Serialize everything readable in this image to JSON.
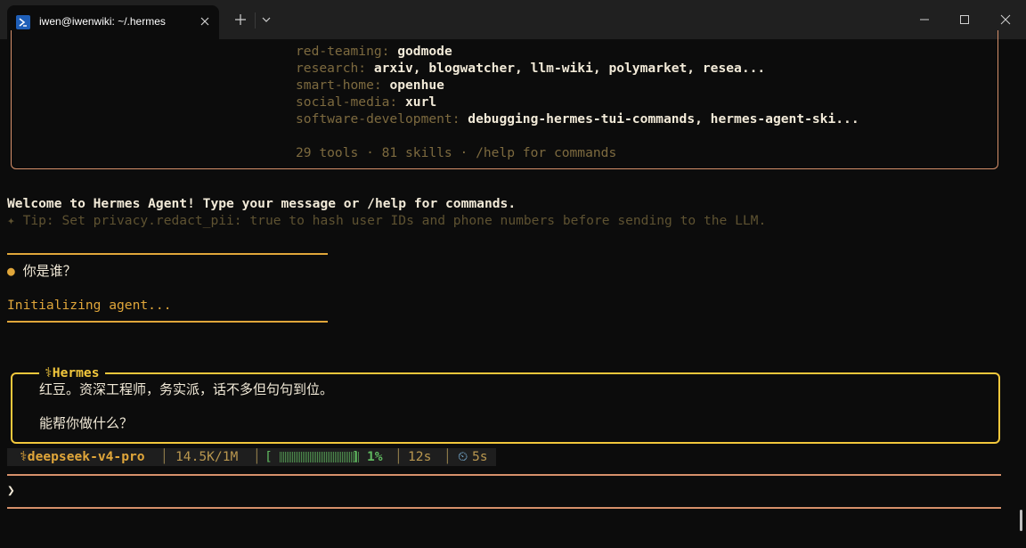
{
  "window": {
    "tab_title": "iwen@iwenwiki: ~/.hermes"
  },
  "banner": {
    "skills": [
      {
        "category": "red-teaming:",
        "items": " godmode"
      },
      {
        "category": "research:",
        "items": " arxiv, blogwatcher, llm-wiki, polymarket, resea..."
      },
      {
        "category": "smart-home:",
        "items": " openhue"
      },
      {
        "category": "social-media:",
        "items": " xurl"
      },
      {
        "category": "software-development:",
        "items": " debugging-hermes-tui-commands, hermes-agent-ski..."
      }
    ],
    "summary": "29 tools · 81 skills · /help for commands"
  },
  "welcome": "Welcome to Hermes Agent! Type your message or /help for commands.",
  "tip": "✦ Tip: Set privacy.redact_pii: true to hash user IDs and phone numbers before sending to the LLM.",
  "user_message": {
    "bullet": "●",
    "text": "你是谁？"
  },
  "init_status": "Initializing agent...",
  "response": {
    "label": "⚕Hermes",
    "lines": [
      "红豆。资深工程师，务实派，话不多但句句到位。",
      "能帮你做什么？"
    ]
  },
  "statusbar": {
    "model": "⚕deepseek-v4-pro",
    "sep": "│",
    "tokens": "14.5K/1M",
    "bar_open": "[",
    "bar_close": "]",
    "percent": "1%",
    "progress": 0.01,
    "elapsed": "12s",
    "timer_icon": "⏲",
    "timer": "5s"
  },
  "prompt": {
    "symbol": "❯",
    "value": ""
  },
  "colors": {
    "accent": "#e0a63a",
    "hermes": "#f2c73c",
    "border": "#d6906a",
    "progress": "#4c8a4c"
  }
}
